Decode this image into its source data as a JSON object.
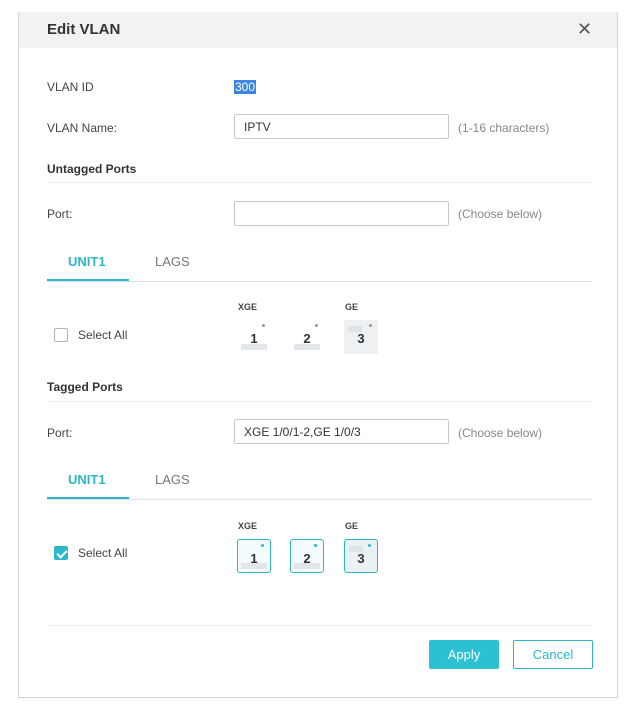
{
  "dialog": {
    "title": "Edit VLAN",
    "close_icon": "close-icon"
  },
  "form": {
    "vlan_id_label": "VLAN ID",
    "vlan_id_value": "300",
    "vlan_name_label": "VLAN Name:",
    "vlan_name_value": "IPTV",
    "vlan_name_hint": "(1-16 characters)"
  },
  "untagged": {
    "title": "Untagged Ports",
    "port_label": "Port:",
    "port_value": "",
    "port_hint": "(Choose below)",
    "tabs": [
      {
        "label": "UNIT1",
        "active": true
      },
      {
        "label": "LAGS",
        "active": false
      }
    ],
    "select_all_label": "Select All",
    "select_all_checked": false,
    "groups": [
      {
        "label": "XGE",
        "ports": [
          "1",
          "2"
        ]
      },
      {
        "label": "GE",
        "ports": [
          "3"
        ]
      }
    ],
    "selected_ports": []
  },
  "tagged": {
    "title": "Tagged Ports",
    "port_label": "Port:",
    "port_value": "XGE 1/0/1-2,GE 1/0/3",
    "port_hint": "(Choose below)",
    "tabs": [
      {
        "label": "UNIT1",
        "active": true
      },
      {
        "label": "LAGS",
        "active": false
      }
    ],
    "select_all_label": "Select All",
    "select_all_checked": true,
    "groups": [
      {
        "label": "XGE",
        "ports": [
          "1",
          "2"
        ]
      },
      {
        "label": "GE",
        "ports": [
          "3"
        ]
      }
    ],
    "selected_ports": [
      "1",
      "2",
      "3"
    ]
  },
  "footer": {
    "apply_label": "Apply",
    "cancel_label": "Cancel"
  },
  "colors": {
    "accent": "#2bb7c9",
    "apply_bg": "#2bc1d3",
    "header_bg": "#f2f2f2",
    "selection_highlight": "#3a86e0"
  }
}
